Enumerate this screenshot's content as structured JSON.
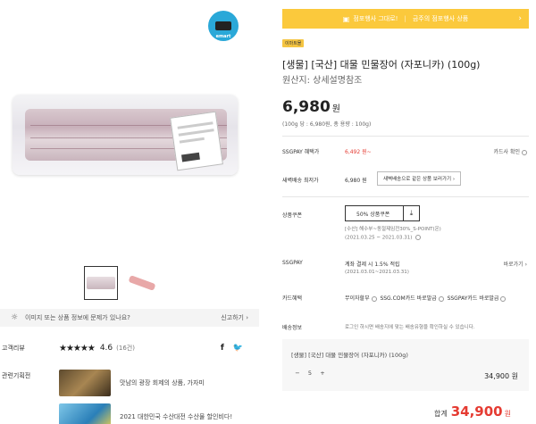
{
  "gallery": {
    "logo_text": "emart"
  },
  "report": {
    "text": "이미지 또는 상품 정보에 문제가 있나요?",
    "link": "신고하기 ›"
  },
  "review": {
    "label": "고객리뷰",
    "stars": "★★★★★",
    "rating": "4.6",
    "count": "(16건)",
    "share_facebook": "f",
    "share_twitter": "🐦"
  },
  "related": {
    "label": "관련기획전",
    "items": [
      {
        "title": "맛남의 광장 회제의 상품, 가자미"
      },
      {
        "title": "2021 대한민국 수산대전 수산물 할인비다!"
      }
    ]
  },
  "promo": {
    "left": "점포행사 그대로!",
    "right": "금주의 점포행사 상품",
    "arrow": "›"
  },
  "product": {
    "badge": "이마트몰",
    "title": "[생물] [국산] 대물 민물장어 (자포니카) (100g)",
    "origin": "원산지: 상세설명참조",
    "price": "6,980",
    "price_unit": "원",
    "unit_price": "(100g 당 : 6,980원, 총 용량 : 100g)"
  },
  "rows": {
    "ssgpay_benefit": {
      "label": "SSGPAY 혜택가",
      "value": "6,492 원~",
      "right": "카드사 확인"
    },
    "dawn_delivery": {
      "label": "새벽배송 최저가",
      "value": "6,980 원",
      "button": "새벽배송으로 같은 상품 보러가기 ›"
    },
    "coupon": {
      "label": "상품쿠폰",
      "button": "50% 상품쿠폰",
      "download_icon": "⤓",
      "desc1": "[수산] 해수부~동절제임전30%_S-POINT(온)",
      "desc2": "(2021.03.25 ~ 2021.03.31)"
    },
    "ssgpay": {
      "label": "SSGPAY",
      "value": "계좌 결제 시 1.5% 적립",
      "sub": "(2021.03.01~2021.03.31)",
      "right": "바로가기 ›"
    },
    "card": {
      "label": "카드혜택",
      "items": [
        "무이자할부",
        "SSG.COM카드 바로발급",
        "SSGPAY카드 바로발급"
      ]
    },
    "delivery": {
      "label": "배송정보",
      "value": "로그인 하시면 배송지에 맞는 배송유형을 확인하실 수 있습니다."
    }
  },
  "order": {
    "name": "[생물] [국산] 대물 민물장어 (자포니카) (100g)",
    "minus": "−",
    "qty": "5",
    "plus": "+",
    "price": "34,900 원"
  },
  "total": {
    "label": "합계",
    "value": "34,900",
    "unit": "원"
  }
}
